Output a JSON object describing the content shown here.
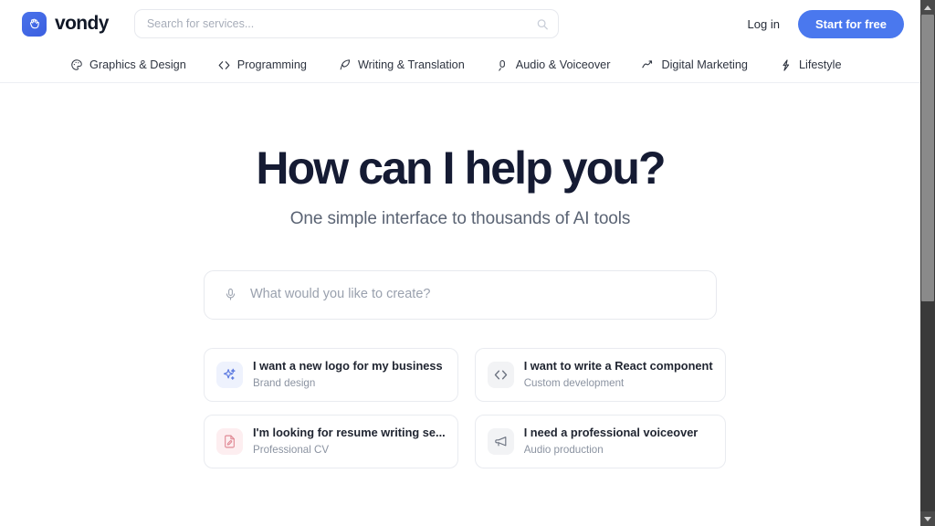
{
  "header": {
    "brand_name": "vondy",
    "brand_icon": "shaka-hand-icon",
    "search": {
      "placeholder": "Search for services...",
      "value": "",
      "icon": "search-icon"
    },
    "login_label": "Log in",
    "cta_label": "Start for free",
    "accent_color": "#4a78ee"
  },
  "nav": {
    "items": [
      {
        "label": "Graphics & Design",
        "icon": "palette-icon"
      },
      {
        "label": "Programming",
        "icon": "code-brackets-icon"
      },
      {
        "label": "Writing & Translation",
        "icon": "quill-pen-icon"
      },
      {
        "label": "Audio & Voiceover",
        "icon": "microphone-icon"
      },
      {
        "label": "Digital Marketing",
        "icon": "trend-up-arrow-icon"
      },
      {
        "label": "Lifestyle",
        "icon": "lightning-bolt-icon"
      }
    ]
  },
  "main": {
    "title": "How can I help you?",
    "subtitle": "One simple interface to thousands of AI tools",
    "title_color": "#151b33",
    "prompt": {
      "placeholder": "What would you like to create?",
      "value": "",
      "icon": "microphone-icon"
    },
    "suggestions": [
      {
        "title": "I want a new logo for my business",
        "subtitle": "Brand design",
        "icon": "sparkles-icon",
        "icon_tone": "blue",
        "icon_color": "#5b79e0"
      },
      {
        "title": "I want to write a React component",
        "subtitle": "Custom development",
        "icon": "code-brackets-icon",
        "icon_tone": "gray",
        "icon_color": "#6b7280"
      },
      {
        "title": "I'm looking for resume writing se...",
        "subtitle": "Professional CV",
        "icon": "file-edit-icon",
        "icon_tone": "red",
        "icon_color": "#e08a95"
      },
      {
        "title": "I need a professional voiceover",
        "subtitle": "Audio production",
        "icon": "megaphone-icon",
        "icon_tone": "gray",
        "icon_color": "#6b7280"
      }
    ]
  },
  "scrollbar": {
    "up_arrow": "scroll-up-arrow-icon",
    "down_arrow": "scroll-down-arrow-icon"
  }
}
